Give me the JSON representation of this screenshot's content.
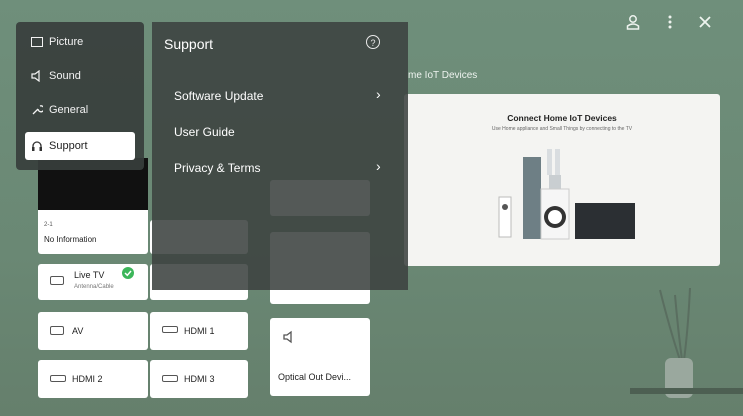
{
  "header": {
    "profile_icon": "profile-icon",
    "menu_icon": "more-vertical-icon",
    "close_icon": "close-icon",
    "hub_section_label": "me IoT Devices"
  },
  "iot_panel": {
    "title": "Connect Home IoT Devices",
    "subtitle": "Use Home appliance and Small Things by connecting to the TV"
  },
  "current_input": {
    "channel": "2-1",
    "status": "No Information"
  },
  "inputs": {
    "live_tv": {
      "label": "Live TV",
      "sublabel": "Antenna/Cable",
      "connected": true
    },
    "av": {
      "label": "AV"
    },
    "hdmi1": {
      "label": "HDMI 1"
    },
    "hdmi2": {
      "label": "HDMI 2"
    },
    "hdmi3": {
      "label": "HDMI 3"
    },
    "optical": {
      "label": "Optical Out Devi..."
    }
  },
  "settings_menu": {
    "items": [
      {
        "label": "Picture",
        "icon": "picture-icon"
      },
      {
        "label": "Sound",
        "icon": "speaker-icon"
      },
      {
        "label": "General",
        "icon": "wrench-icon"
      },
      {
        "label": "Support",
        "icon": "headset-icon",
        "selected": true
      }
    ]
  },
  "support_panel": {
    "title": "Support",
    "help_icon": "help-icon",
    "items": [
      {
        "label": "Software Update",
        "has_arrow": true
      },
      {
        "label": "User Guide",
        "has_arrow": false
      },
      {
        "label": "Privacy & Terms",
        "has_arrow": true
      }
    ]
  },
  "colors": {
    "background": "#6b8a77",
    "menu_bg": "#373e3c",
    "selected_bg": "#ffffff",
    "connected_check": "#3cb65a"
  }
}
